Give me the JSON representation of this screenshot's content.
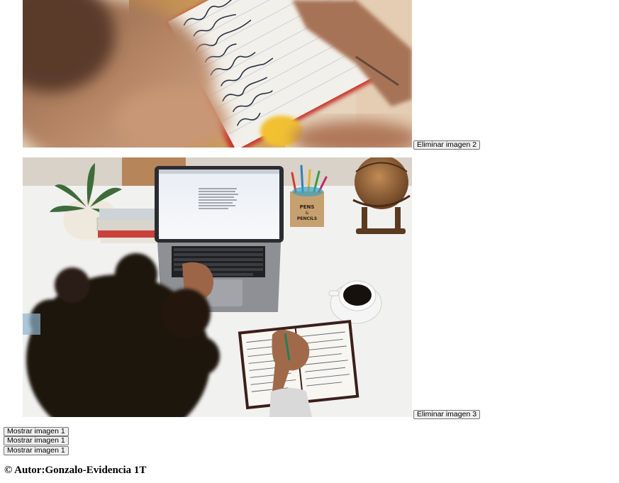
{
  "images": [
    {
      "delete_label": "Eliminar imagen 2"
    },
    {
      "delete_label": "Eliminar imagen 3"
    }
  ],
  "show_buttons": [
    {
      "label": "Mostrar imagen 1"
    },
    {
      "label": "Mostrar imagen 1"
    },
    {
      "label": "Mostrar imagen 1"
    }
  ],
  "footer": {
    "text": "© Autor:Gonzalo-Evidencia 1T"
  }
}
